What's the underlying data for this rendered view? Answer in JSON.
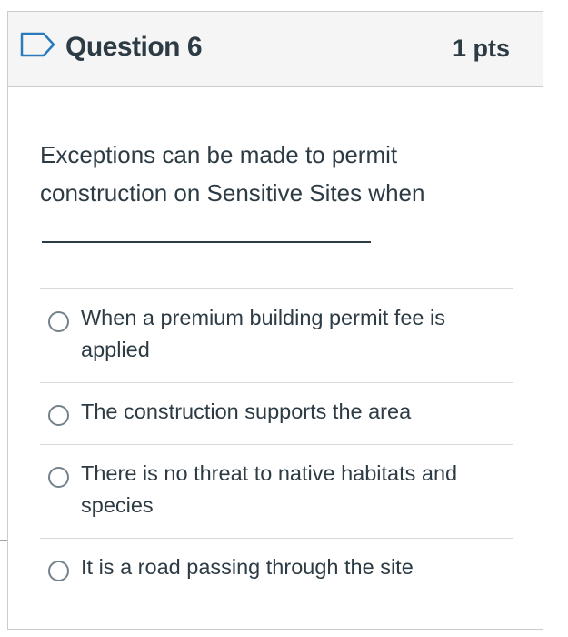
{
  "question": {
    "title": "Question 6",
    "points": "1 pts",
    "text": "Exceptions can be made to permit construction on Sensitive Sites when",
    "flag_icon": "bookmark-flag-icon"
  },
  "answers": [
    {
      "label": "When a premium building permit fee is applied",
      "selected": false
    },
    {
      "label": "The construction supports the area",
      "selected": false
    },
    {
      "label": "There is no threat to native habitats and species",
      "selected": false
    },
    {
      "label": "It is a road passing through the site",
      "selected": false
    }
  ],
  "colors": {
    "text": "#2d3b45",
    "header_bg": "#f5f5f5",
    "border": "#c7cdd1",
    "flag": "#2b7abc",
    "radio": "#73818a"
  }
}
